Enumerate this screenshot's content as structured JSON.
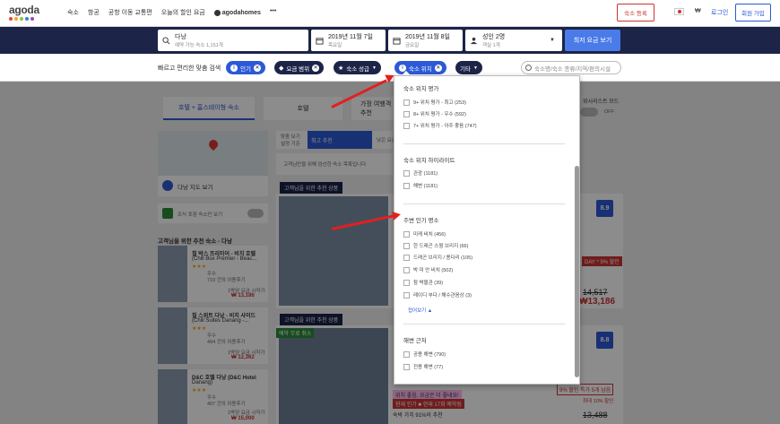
{
  "brand": {
    "name": "agoda",
    "dot_colors": [
      "#e8413c",
      "#f4a623",
      "#8ac43f",
      "#2c84d8",
      "#9b4aa0"
    ]
  },
  "nav": {
    "items": [
      "숙소",
      "항공",
      "공항 이동 교통편",
      "오늘의 할인 요금"
    ],
    "home": "agodahomes",
    "more": "•••"
  },
  "header_right": {
    "list_property": "숙소 등록",
    "currency": "₩",
    "login": "로그인",
    "signup": "회원 가입"
  },
  "search": {
    "destination": {
      "title": "다낭",
      "sub": "예약 가능 숙소 1,151개"
    },
    "checkin": {
      "title": "2019년 11월 7일",
      "sub": "목요일"
    },
    "checkout": {
      "title": "2019년 11월 8일",
      "sub": "금요일"
    },
    "guests": {
      "title": "성인 2명",
      "sub": "객실 1개"
    },
    "button": "최저 요금 보기"
  },
  "filters": {
    "label": "빠르고 편리한 맞춤 검색",
    "chips": [
      "인기",
      "요금 범위",
      "숙소 성급",
      "숙소 위치",
      "기타"
    ],
    "search_placeholder": "숙소명/숙소 종류/지역/편의시설"
  },
  "tabs": {
    "all": "호텔 + 홈스테이형 숙소",
    "hotel": "호텔",
    "home": "가정 여행객 추천",
    "wish": "위시리스트 모드",
    "off": "OFF"
  },
  "sort": {
    "best_match": [
      "맞춤 보기",
      "설정 기준"
    ],
    "recommended": "최고 추천",
    "lowest": "낮은 요금"
  },
  "left": {
    "map_button": "다낭 지도 보기",
    "breakfast_toggle": "조식 포함 숙소만 보기",
    "rec_title": "고객님을 위한 추천 숙소 - 다낭"
  },
  "rec_hotels": [
    {
      "name": "칠 박스 프리미어 - 비치 호텔",
      "en": "(Chill Box Premier - Beac...",
      "rating_label": "우수",
      "reviews": "710 건의 이용후기",
      "pre": "1박당 요금 시작가",
      "price": "₩ 13,186"
    },
    {
      "name": "칠 스위트 다낭 - 비치 사이드",
      "en": "(Chill Suites Danang -...",
      "rating_label": "우수",
      "reviews": "494 건의 이용후기",
      "pre": "1박당 요금 시작가",
      "price": "₩ 12,362"
    },
    {
      "name": "D&C 호텔 다낭 (D&C Hotel",
      "en": "Danang)",
      "rating_label": "우수",
      "reviews": "407 건의 이용후기",
      "pre": "1박당 요금 시작가",
      "price": "₩ 15,000"
    }
  ],
  "results": {
    "notice": "고객님만을 위해 엄선한 숙소 목록입니다",
    "rec_tag": "고객님을 위한 추천 상품",
    "free_cancel": "예약 무료 취소",
    "score1": "8.9",
    "score2": "8.8",
    "discount": "DAY * 9% 할인",
    "price1_old": "14,517",
    "price1": "₩13,186",
    "deal": "9% 할인 특가 5개 남음",
    "price2_old": "13,488",
    "deal_small": "최대 10% 할인",
    "recent": "현재 인기 ■ 현재 17회 예약됨",
    "guarantee": "숙박 가치 91%의 추천",
    "loc_deal": "위치 좋음, 요금은 더 좋네요!"
  },
  "dropdown": {
    "sec1": {
      "title": "숙소 위치 평가",
      "items": [
        "9+ 위치 평가 - 최고 (253)",
        "8+ 위치 평가 - 우수 (592)",
        "7+ 위치 평가 - 아주 좋음 (747)"
      ]
    },
    "sec2": {
      "title": "숙소 위치 하이라이트",
      "items": [
        "관광 (1181)",
        "해변 (1181)"
      ]
    },
    "sec3": {
      "title": "주변 인기 명소",
      "items": [
        "미케 비치 (456)",
        "한 드래곤 스윙 브리지 (66)",
        "드래곤 브리지 / 용다리 (105)",
        "박 미 안 비치 (502)",
        "참 박물관 (39)",
        "레이디 부다 / 해수관음상 (3)"
      ],
      "less": "접어보기"
    },
    "sec4": {
      "title": "해변 근처",
      "items": [
        "공용 해변 (790)",
        "전용 해변 (77)"
      ]
    }
  }
}
